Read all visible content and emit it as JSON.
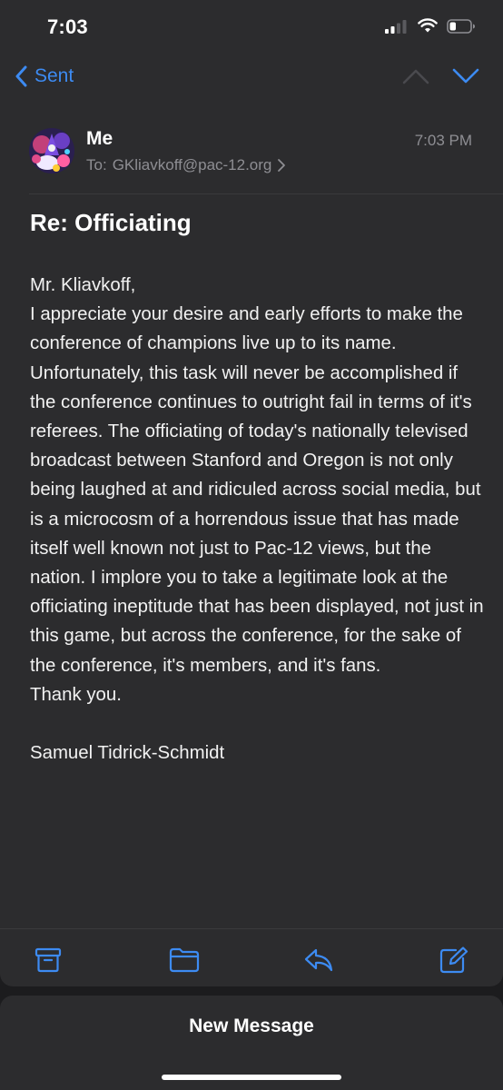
{
  "status_bar": {
    "time": "7:03"
  },
  "nav": {
    "back_label": "Sent",
    "prev_icon": "chevron-up-icon",
    "next_icon": "chevron-down-icon"
  },
  "header": {
    "sender": "Me",
    "to_prefix": "To:",
    "recipient": "GKliavkoff@pac-12.org",
    "time": "7:03 PM"
  },
  "message": {
    "subject": "Re: Officiating",
    "greeting": "Mr. Kliavkoff,",
    "body": "I appreciate your desire and early efforts to make the conference of champions live up to its name. Unfortunately, this task will never be accomplished if the conference continues to outright fail in terms of it's referees. The officiating of today's nationally televised broadcast between Stanford and Oregon is not only being laughed at and ridiculed across social media, but is a microcosm of a horrendous issue that has made itself well known not just to Pac-12 views, but the nation. I implore you to take a legitimate look at the officiating ineptitude that has been displayed, not just in this game, but across the conference, for the sake of the conference, it's members, and it's fans.",
    "closing": "Thank you.",
    "signature": "Samuel Tidrick-Schmidt"
  },
  "toolbar": {
    "items": [
      "archive-icon",
      "folder-icon",
      "reply-icon",
      "compose-icon"
    ]
  },
  "new_message": {
    "label": "New Message"
  },
  "colors": {
    "accent": "#3d8bf2",
    "background": "#2c2c2e",
    "secondary_text": "#8e8e93"
  }
}
